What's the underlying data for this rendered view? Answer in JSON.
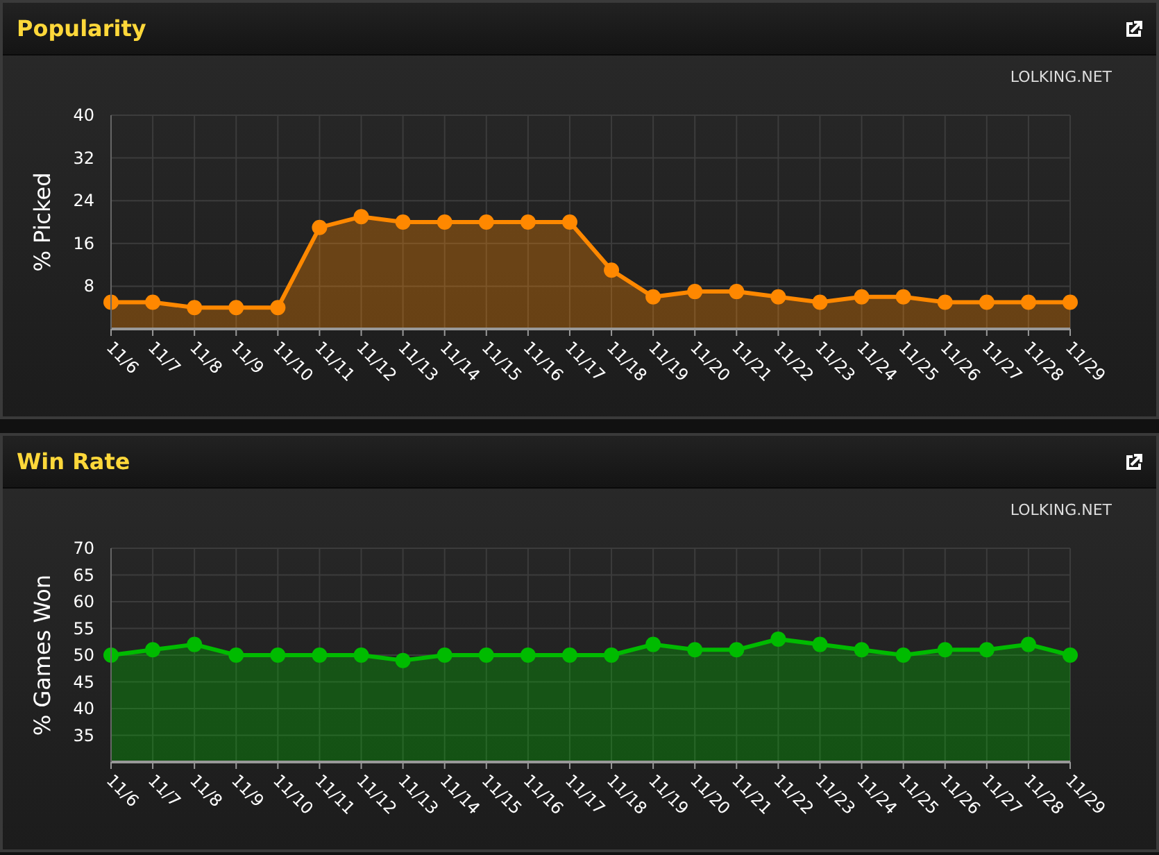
{
  "panels": [
    {
      "title": "Popularity",
      "credit": "LOLKING.NET",
      "chart_data": {
        "type": "area",
        "ylabel": "% Picked",
        "categories": [
          "11/6",
          "11/7",
          "11/8",
          "11/9",
          "11/10",
          "11/11",
          "11/12",
          "11/13",
          "11/14",
          "11/15",
          "11/16",
          "11/17",
          "11/18",
          "11/19",
          "11/20",
          "11/21",
          "11/22",
          "11/23",
          "11/24",
          "11/25",
          "11/26",
          "11/27",
          "11/28",
          "11/29"
        ],
        "ylim": [
          0,
          40
        ],
        "yticks": [
          8,
          16,
          24,
          32,
          40
        ],
        "grid": true,
        "series": [
          {
            "color": "#ff8800",
            "values": [
              5,
              5,
              4,
              4,
              4,
              19,
              21,
              20,
              20,
              20,
              20,
              20,
              11,
              6,
              7,
              7,
              6,
              5,
              6,
              6,
              5,
              5,
              5,
              5
            ]
          }
        ]
      }
    },
    {
      "title": "Win Rate",
      "credit": "LOLKING.NET",
      "chart_data": {
        "type": "area",
        "ylabel": "% Games Won",
        "categories": [
          "11/6",
          "11/7",
          "11/8",
          "11/9",
          "11/10",
          "11/11",
          "11/12",
          "11/13",
          "11/14",
          "11/15",
          "11/16",
          "11/17",
          "11/18",
          "11/19",
          "11/20",
          "11/21",
          "11/22",
          "11/23",
          "11/24",
          "11/25",
          "11/26",
          "11/27",
          "11/28",
          "11/29"
        ],
        "ylim": [
          30,
          70
        ],
        "yticks": [
          35,
          40,
          45,
          50,
          55,
          60,
          65,
          70
        ],
        "grid": true,
        "series": [
          {
            "color": "#00bb00",
            "values": [
              50,
              51,
              52,
              50,
              50,
              50,
              50,
              49,
              50,
              50,
              50,
              50,
              50,
              52,
              51,
              51,
              53,
              52,
              51,
              50,
              51,
              51,
              52,
              50
            ]
          }
        ]
      }
    }
  ]
}
